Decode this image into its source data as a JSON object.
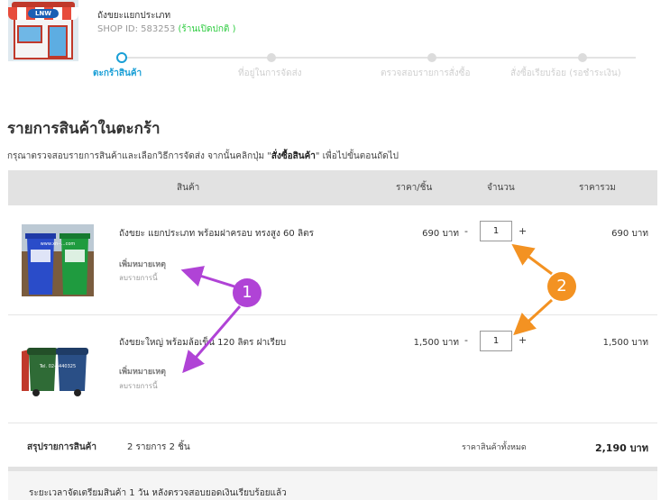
{
  "shop": {
    "logo_text": "LNW",
    "name": "ถังขยะแยกประเภท",
    "id_label": "SHOP ID: 583253",
    "status": "(ร้านเปิดปกติ )"
  },
  "steps": [
    {
      "label": "ตะกร้าสินค้า",
      "active": true
    },
    {
      "label": "ที่อยู่ในการจัดส่ง",
      "active": false
    },
    {
      "label": "ตรวจสอบรายการสั่งซื้อ",
      "active": false
    },
    {
      "label": "สั่งซื้อเรียบร้อย (รอชำระเงิน)",
      "active": false
    }
  ],
  "page_title": "รายการสินค้าในตะกร้า",
  "instruction": {
    "prefix": "กรุณาตรวจสอบรายการสินค้าและเลือกวิธีการจัดส่ง จากนั้นคลิกปุ่ม \"",
    "button_ref": "สั่งซื้อสินค้า",
    "suffix": "\" เพื่อไปขั้นตอนถัดไป"
  },
  "table": {
    "headers": {
      "product": "สินค้า",
      "unit_price": "ราคา/ชิ้น",
      "quantity": "จำนวน",
      "total": "ราคารวม"
    },
    "rows": [
      {
        "name": "ถังขยะ แยกประเภท พร้อมฝาครอบ ทรงสูง 60 ลิตร",
        "add_note": "เพิ่มหมายเหตุ",
        "remove": "ลบรายการนี้",
        "price": "690 บาท",
        "minus": "-",
        "qty": "1",
        "plus": "+",
        "total": "690 บาท",
        "image_text": "www.xn--...com"
      },
      {
        "name": "ถังขยะใหญ่ พร้อมล้อเข็น 120 ลิตร ฝาเรียบ",
        "add_note": "เพิ่มหมายเหตุ",
        "remove": "ลบรายการนี้",
        "price": "1,500 บาท",
        "minus": "-",
        "qty": "1",
        "plus": "+",
        "total": "1,500 บาท",
        "image_text": "Tel. 02-5440325"
      }
    ]
  },
  "summary": {
    "label": "สรุปรายการสินค้า",
    "count": "2 รายการ 2 ชิ้น",
    "all_label": "ราคาสินค้าทั้งหมด",
    "all_value": "2,190 บาท"
  },
  "prep_text": "ระยะเวลาจัดเตรียมสินค้า 1 วัน หลังตรวจสอบยอดเงินเรียบร้อยแล้ว",
  "annotations": {
    "callout_1": "1",
    "callout_2": "2",
    "color_purple": "#b043d6",
    "color_orange": "#f39222"
  },
  "colors": {
    "accent": "#1a9fd6",
    "open_status": "#2ecc40",
    "header_bg": "#e2e2e2"
  }
}
